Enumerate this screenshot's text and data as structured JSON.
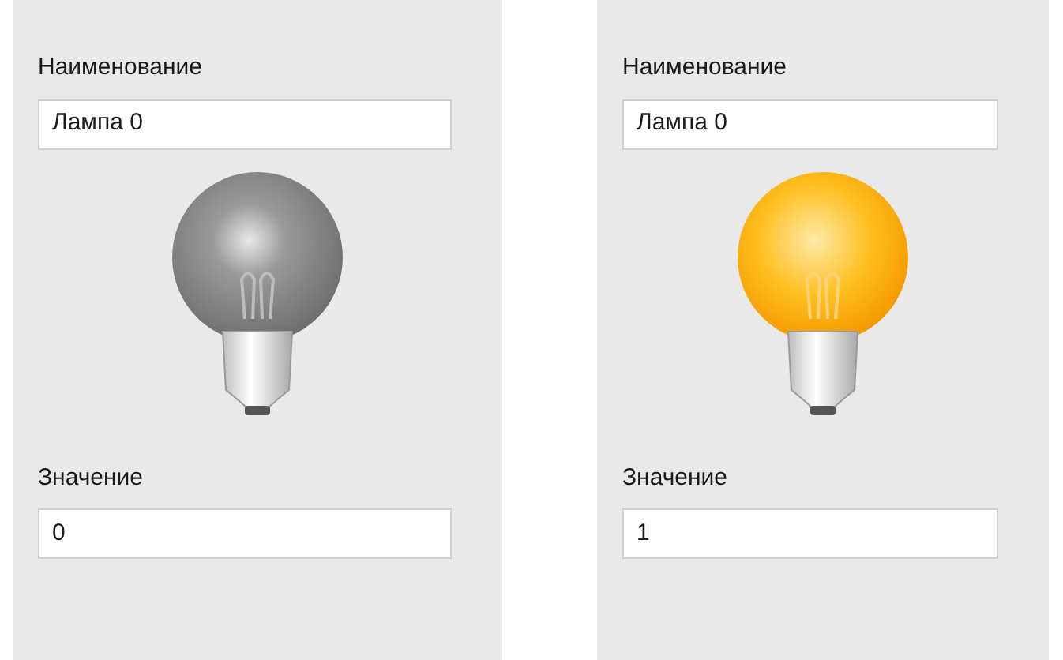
{
  "panels": [
    {
      "name_label": "Наименование",
      "name_value": "Лампа 0",
      "lamp": {
        "on": false
      },
      "value_label": "Значение",
      "value": "0"
    },
    {
      "name_label": "Наименование",
      "name_value": "Лампа 0",
      "lamp": {
        "on": true
      },
      "value_label": "Значение",
      "value": "1"
    }
  ]
}
